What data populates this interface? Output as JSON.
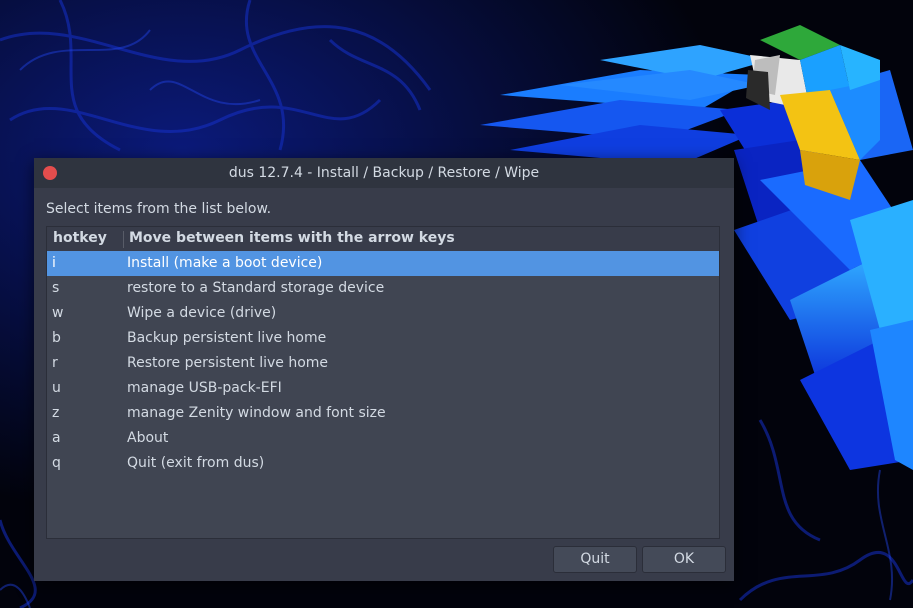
{
  "window": {
    "title": "dus 12.7.4 - Install / Backup / Restore / Wipe"
  },
  "dialog": {
    "prompt": "Select items from the list below.",
    "columns": {
      "hotkey": "hotkey",
      "description": "Move between items with the arrow keys"
    },
    "items": [
      {
        "key": "i",
        "label": "Install (make a boot device)",
        "selected": true
      },
      {
        "key": "s",
        "label": "restore to a Standard storage device",
        "selected": false
      },
      {
        "key": "w",
        "label": "Wipe a device (drive)",
        "selected": false
      },
      {
        "key": "b",
        "label": "Backup persistent live home",
        "selected": false
      },
      {
        "key": "r",
        "label": "Restore persistent live home",
        "selected": false
      },
      {
        "key": "u",
        "label": "manage USB-pack-EFI",
        "selected": false
      },
      {
        "key": "z",
        "label": "manage Zenity window and font size",
        "selected": false
      },
      {
        "key": "a",
        "label": "About",
        "selected": false
      },
      {
        "key": "q",
        "label": "Quit (exit from dus)",
        "selected": false
      }
    ],
    "buttons": {
      "quit": "Quit",
      "ok": "OK"
    }
  },
  "colors": {
    "selection": "#5294e2",
    "dialog_bg": "#383c4a",
    "close_button": "#e44d4d"
  }
}
